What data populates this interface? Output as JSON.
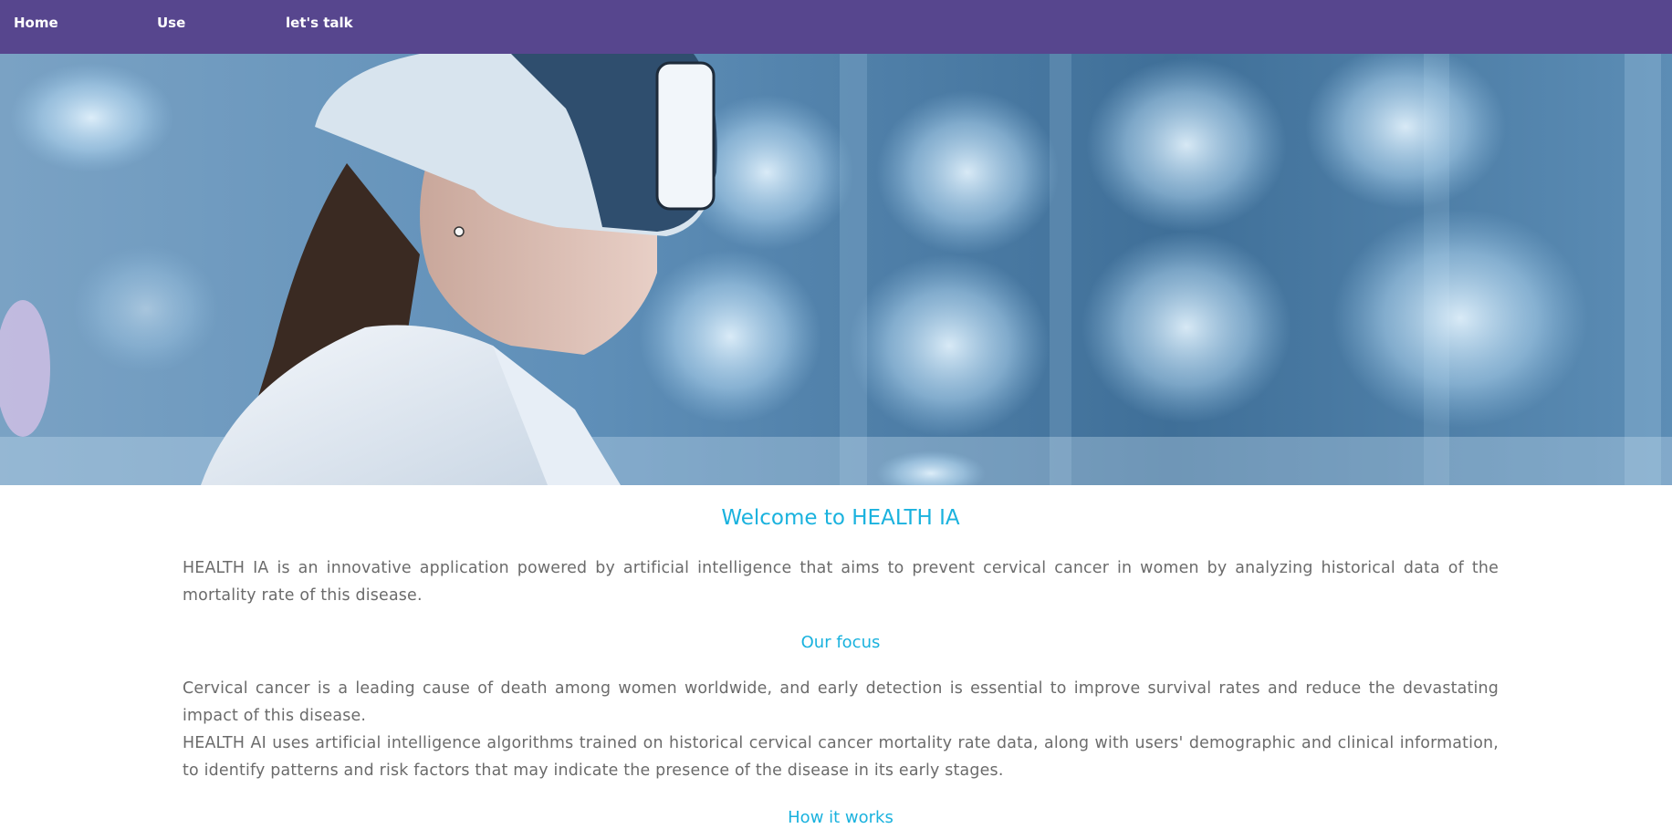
{
  "nav": {
    "items": [
      {
        "label": "Home"
      },
      {
        "label": "Use"
      },
      {
        "label": "let's talk"
      }
    ],
    "background": "#57468e"
  },
  "hero": {
    "image": "woman-with-vr-headset-and-holographic-uterus-models"
  },
  "main": {
    "title": "Welcome to HEALTH IA",
    "intro": "HEALTH IA is an innovative application powered by artificial intelligence that aims to prevent cervical cancer in women by analyzing historical data of the mortality rate of this disease.",
    "focus_heading": "Our focus",
    "focus_p1": "Cervical cancer is a leading cause of death among women worldwide, and early detection is essential to improve survival rates and reduce the devastating impact of this disease.",
    "focus_p2": "HEALTH AI uses artificial intelligence algorithms trained on historical cervical cancer mortality rate data, along with users' demographic and clinical information, to identify patterns and risk factors that may indicate the presence of the disease in its early stages.",
    "how_heading": "How it works"
  },
  "colors": {
    "accent": "#1ab2de",
    "body_text": "#6b6b6b"
  }
}
